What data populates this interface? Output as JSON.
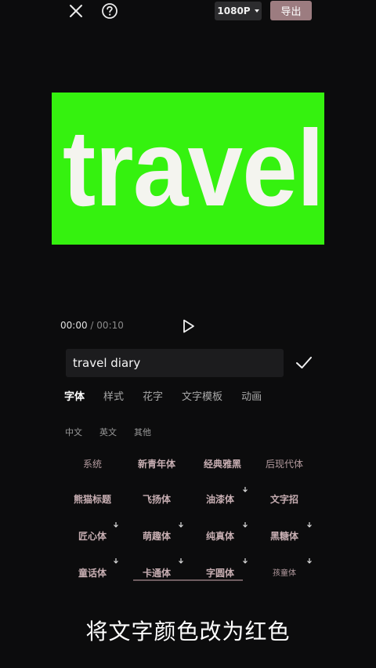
{
  "topbar": {
    "resolution": "1080P",
    "export_label": "导出"
  },
  "preview": {
    "text": "travel",
    "background": "#35f20f"
  },
  "playback": {
    "current": "00:00",
    "separator": "/",
    "duration": "00:10"
  },
  "text_input": {
    "value": "travel diary"
  },
  "tabs": [
    "字体",
    "样式",
    "花字",
    "文字模板",
    "动画"
  ],
  "subtabs": [
    "中文",
    "英文",
    "其他"
  ],
  "fonts": {
    "row1": [
      "系统",
      "新青年体",
      "经典雅黑",
      "后现代体"
    ],
    "row2": [
      "熊猫标题",
      "飞扬体",
      "油漆体",
      "文字招"
    ],
    "row3": [
      "匠心体",
      "萌趣体",
      "纯真体",
      "黑糖体"
    ],
    "row4": [
      "童话体",
      "卡通体",
      "字圆体",
      "孩童体"
    ]
  },
  "caption": "将文字颜色改为红色",
  "colors": {
    "accent": "#9c7c80",
    "font_label": "#b39a9e"
  }
}
